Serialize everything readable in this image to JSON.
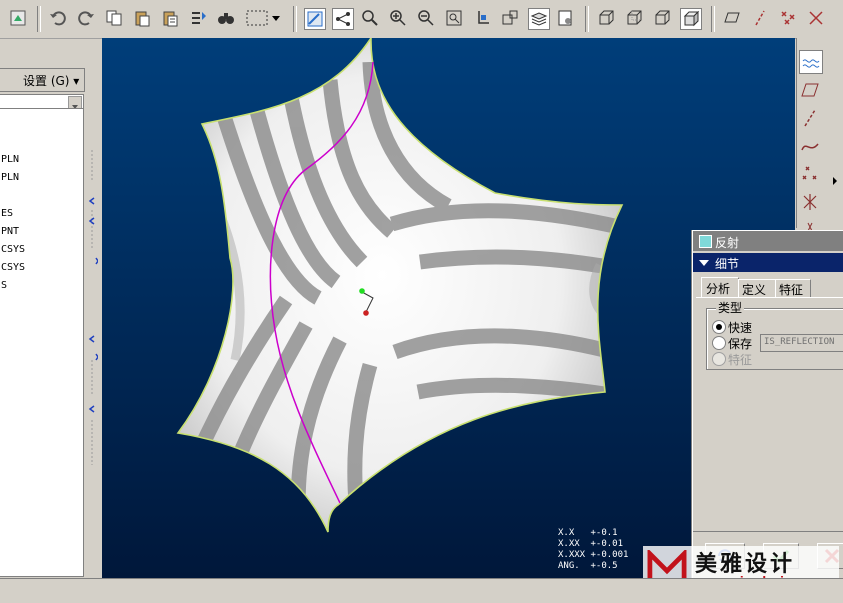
{
  "settings_label": "设置 (G) ▾",
  "model_tree": [
    "PLN",
    "PLN",
    "ES",
    "PNT",
    "CSYS",
    "CSYS",
    "S"
  ],
  "dialog": {
    "title": "反射",
    "section": "细节",
    "tabs": [
      "分析",
      "定义",
      "特征"
    ],
    "group": "类型",
    "options": [
      "快速",
      "保存",
      "特征"
    ],
    "name_value": "IS_REFLECTION"
  },
  "tolerance": [
    "X.X   +-0.1",
    "X.XX  +-0.01",
    "X.XXX +-0.001",
    "ANG.  +-0.5"
  ],
  "watermark": {
    "brand": "美雅设计",
    "url": "www.meiyadesign.com"
  }
}
